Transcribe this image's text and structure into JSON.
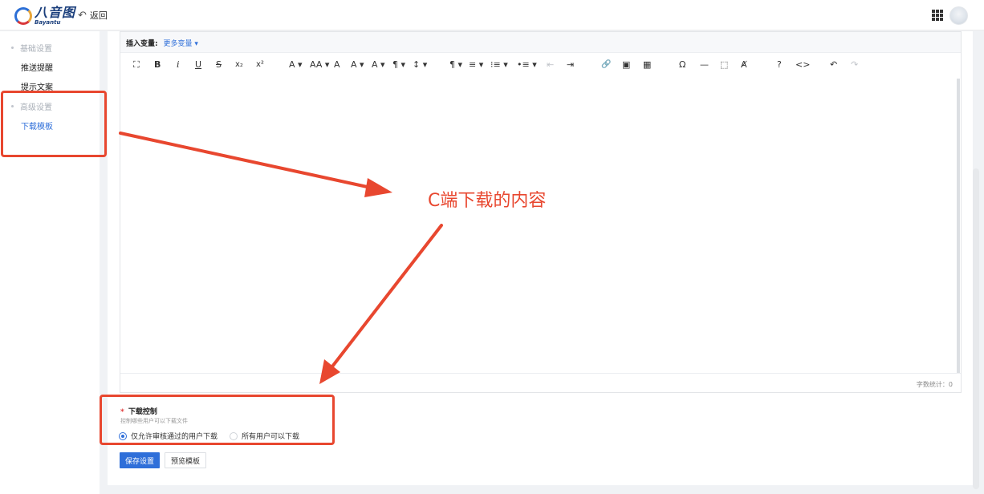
{
  "header": {
    "logo_cn": "八音图",
    "logo_en": "Bayantu",
    "back_label": "返回"
  },
  "sidebar": {
    "groups": [
      {
        "label": "基础设置",
        "items": [
          "推送提醒",
          "提示文案"
        ]
      },
      {
        "label": "高级设置",
        "items": [
          "下载模板"
        ]
      }
    ],
    "active_item": "下载模板"
  },
  "editor": {
    "insert_var_label": "插入变量:",
    "more_vars_label": "更多变量",
    "word_count": "字数统计：0",
    "toolbar_glyphs": {
      "fullscreen": "⛶",
      "bold": "B",
      "italic": "i",
      "underline": "U",
      "strike": "S",
      "subscript": "x₂",
      "superscript": "x²",
      "font_color": "A ▾",
      "font_size": "AA ▾",
      "font_family": "A",
      "highlight": "A ▾",
      "text_style": "A ▾",
      "paragraph_style": "¶ ▾",
      "line_height": "↕ ▾",
      "paragraph": "¶ ▾",
      "align": "≡ ▾",
      "ordered_list": "⁝≡ ▾",
      "bullet_list": "•≡ ▾",
      "outdent": "⇤",
      "indent": "⇥",
      "link": "🔗",
      "image": "▣",
      "table": "▦",
      "omega": "Ω",
      "hr": "—",
      "select_all": "⬚",
      "clear_format": "Ⱥ",
      "help": "?",
      "code": "<>",
      "undo": "↶",
      "redo": "↷"
    }
  },
  "form": {
    "download_control_label": "下载控制",
    "required_mark": "*",
    "download_control_hint": "控制哪些用户可以下载文件",
    "options": [
      "仅允许审核通过的用户下载",
      "所有用户可以下载"
    ],
    "selected_option": "仅允许审核通过的用户下载",
    "save_label": "保存设置",
    "preview_label": "预览模板"
  },
  "annotation": {
    "text": "C端下载的内容",
    "color": "#e8472f"
  },
  "colors": {
    "accent": "#2f6fd9",
    "annotation": "#e8472f"
  }
}
